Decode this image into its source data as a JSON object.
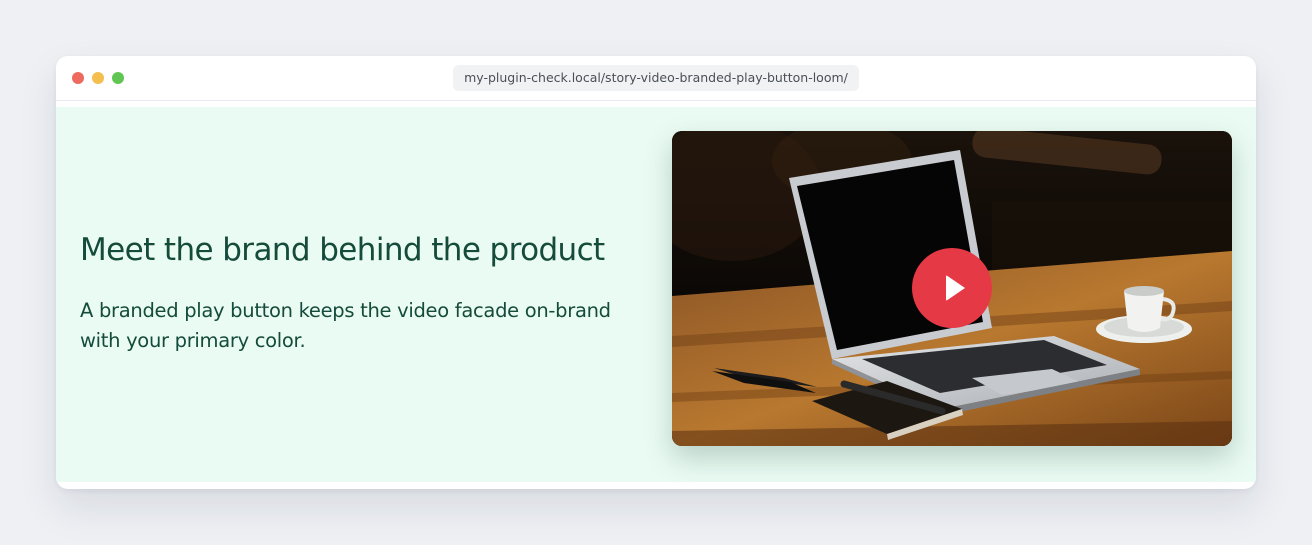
{
  "browser": {
    "url": "my-plugin-check.local/story-video-branded-play-button-loom/"
  },
  "hero": {
    "title": "Meet the brand behind the product",
    "description": "A branded play button keeps the video facade on-brand with your primary color."
  },
  "video": {
    "thumbnail": "laptop-on-wooden-table-photo",
    "play_icon": "play-icon"
  },
  "colors": {
    "primary": "#e63946",
    "heading": "#144b3b",
    "content_bg": "#eafbf3"
  }
}
